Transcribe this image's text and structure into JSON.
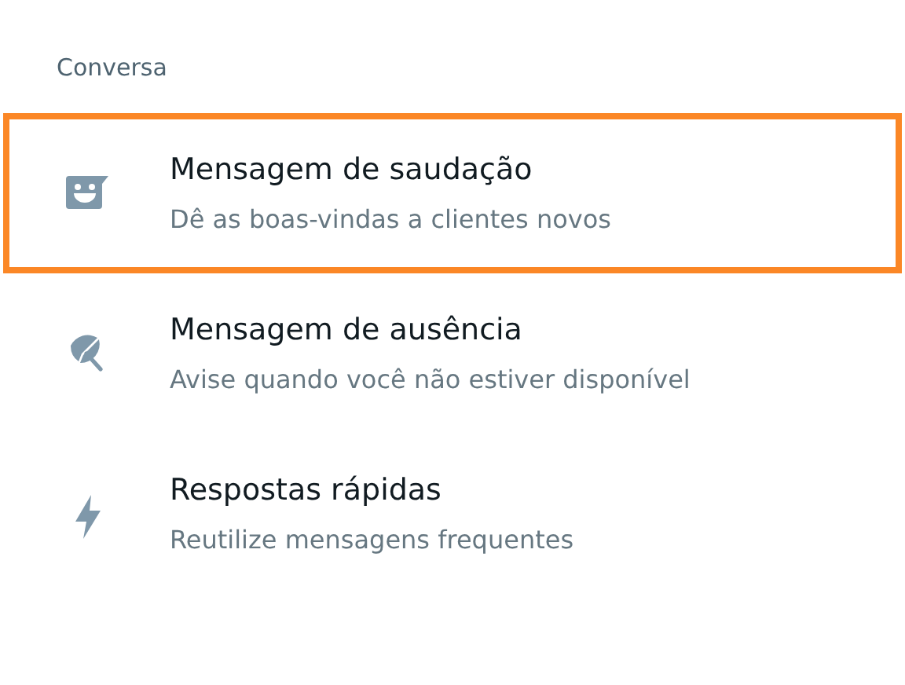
{
  "section": {
    "title": "Conversa"
  },
  "items": [
    {
      "kind": "greeting",
      "title": "Mensagem de saudação",
      "subtitle": "Dê as boas-vindas a clientes novos",
      "selected": true
    },
    {
      "kind": "away",
      "title": "Mensagem de ausência",
      "subtitle": "Avise quando você não estiver disponível",
      "selected": false
    },
    {
      "kind": "quick",
      "title": "Respostas rápidas",
      "subtitle": "Reutilize mensagens frequentes",
      "selected": false
    }
  ]
}
